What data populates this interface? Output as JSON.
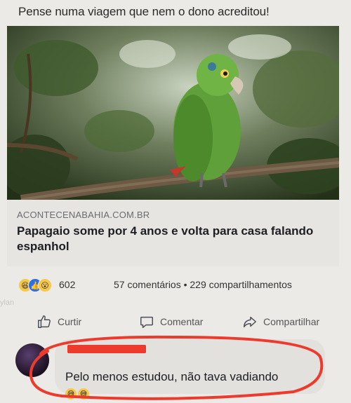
{
  "caption": "Pense numa viagem que nem o dono acreditou!",
  "link_preview": {
    "domain": "ACONTECENABAHIA.COM.BR",
    "headline": "Papagaio some por 4 anos e volta para casa falando espanhol"
  },
  "engagement": {
    "reaction_icons": [
      "haha-reaction-icon",
      "like-reaction-icon",
      "wow-reaction-icon"
    ],
    "reaction_count": "602",
    "stats": "57 comentários • 229 compartilhamentos"
  },
  "watermark": "ylan",
  "actions": {
    "like_label": "Curtir",
    "comment_label": "Comentar",
    "share_label": "Compartilhar"
  },
  "comment": {
    "text": "Pelo menos estudou, não tava vadiando",
    "emoji": [
      "grinning-sweat-emoji",
      "grinning-sweat-emoji"
    ]
  },
  "colors": {
    "highlight_red": "#ec3b2d",
    "like_blue": "#2f6fe3",
    "reaction_yellow": "#f7c747"
  }
}
